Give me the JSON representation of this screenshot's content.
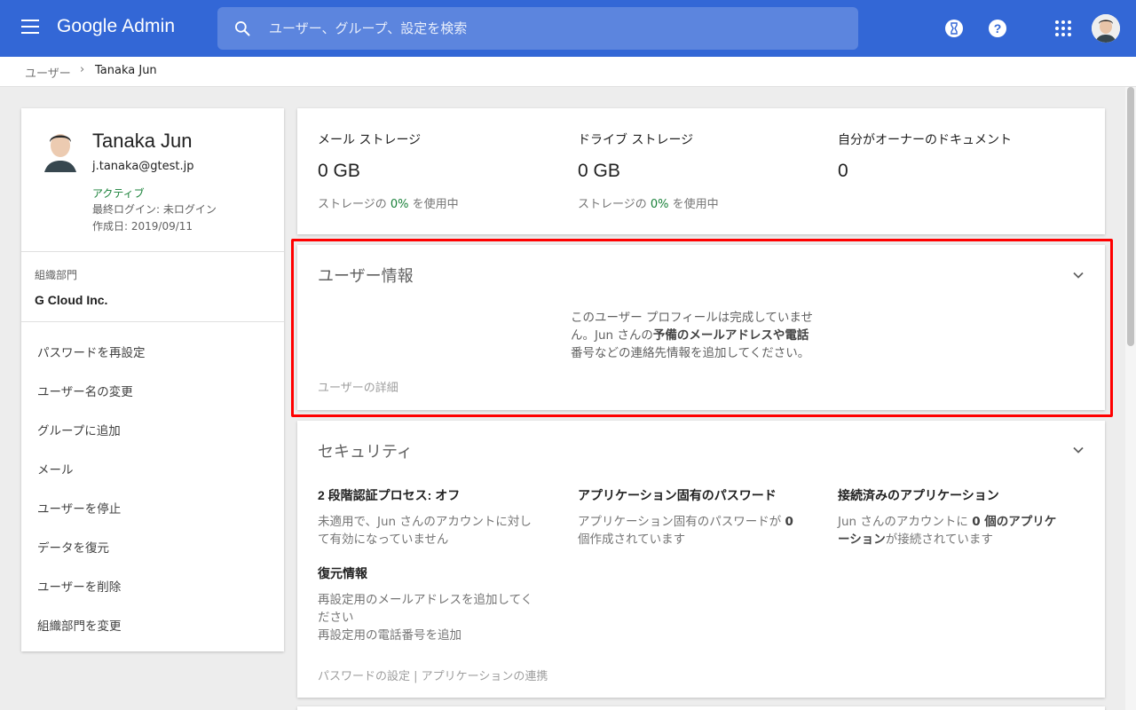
{
  "header": {
    "brand": "Google Admin",
    "search_placeholder": "ユーザー、グループ、設定を検索"
  },
  "breadcrumb": {
    "root": "ユーザー",
    "current": "Tanaka Jun"
  },
  "profile": {
    "name": "Tanaka Jun",
    "email": "j.tanaka@gtest.jp",
    "status": "アクティブ",
    "last_login": "最終ログイン: 未ログイン",
    "created": "作成日: 2019/09/11",
    "org_label": "組織部門",
    "org_value": "G Cloud Inc."
  },
  "actions": [
    "パスワードを再設定",
    "ユーザー名の変更",
    "グループに追加",
    "メール",
    "ユーザーを停止",
    "データを復元",
    "ユーザーを削除",
    "組織部門を変更"
  ],
  "storage": {
    "mail": {
      "title": "メール ストレージ",
      "value": "0 GB",
      "usage_prefix": "ストレージの",
      "usage_pct": "0%",
      "usage_suffix": "を使用中"
    },
    "drive": {
      "title": "ドライブ ストレージ",
      "value": "0 GB",
      "usage_prefix": "ストレージの",
      "usage_pct": "0%",
      "usage_suffix": "を使用中"
    },
    "docs": {
      "title": "自分がオーナーのドキュメント",
      "value": "0"
    }
  },
  "user_info": {
    "title": "ユーザー情報",
    "msg_line1": "このユーザー プロフィールは完成していませ",
    "msg_line2a": "ん。Jun さんの",
    "msg_line2b": "予備のメールアドレスや電話",
    "msg_line3": "番号などの連絡先情報を追加してください。",
    "link": "ユーザーの詳細"
  },
  "security": {
    "title": "セキュリティ",
    "two_step": {
      "head": "2 段階認証プロセス: ",
      "head_value": "オフ",
      "line1": "未適用で、Jun さんのアカウントに対し",
      "line2": "て有効になっていません"
    },
    "app_pw": {
      "head": "アプリケーション固有のパスワード",
      "line1a": "アプリケーション固有のパスワードが ",
      "line1b": "0",
      "line2": "個作成されています"
    },
    "connected": {
      "head": "接続済みのアプリケーション",
      "line1a": "Jun さんのアカウントに ",
      "line1b": "0 個のアプリケ",
      "line2a": "ーション",
      "line2b": "が接続されています"
    },
    "recovery": {
      "head": "復元情報",
      "line1": "再設定用のメールアドレスを追加してく",
      "line2": "ださい",
      "line3": "再設定用の電話番号を追加"
    },
    "footer_link1": "パスワードの設定",
    "footer_sep": " | ",
    "footer_link2": "アプリケーションの連携"
  },
  "colors": {
    "header_bg": "#3367d6",
    "active_green": "#188038",
    "highlight": "#ff0000"
  }
}
